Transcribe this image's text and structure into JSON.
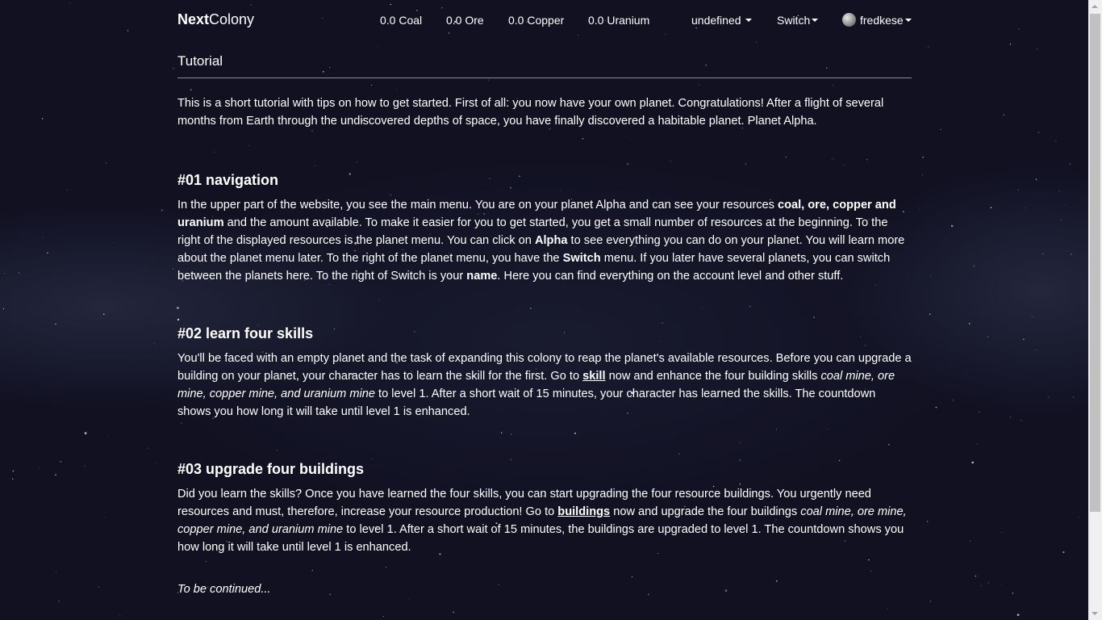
{
  "navbar": {
    "brand_bold": "Next",
    "brand_rest": "Colony",
    "resources": [
      "0.0 Coal",
      "0.0 Ore",
      "0.0 Copper",
      "0.0 Uranium"
    ],
    "planet_menu": "undefined",
    "switch_menu": "Switch",
    "user_menu": "fredkese"
  },
  "page": {
    "title": "Tutorial",
    "intro": "This is a short tutorial with tips on how to get started. First of all: you now have your own planet. Congratulations! After a flight of several months from Earth through the undiscovered depths of space, you have finally discovered a habitable planet. Planet Alpha.",
    "sections": [
      {
        "heading": "#01 navigation",
        "parts": [
          "In the upper part of the website, you see the main menu. You are on your planet Alpha and can see your resources ",
          "coal, ore, copper and uranium",
          " and the amount available. To make it easier for you to get started, you get a small number of resources at the beginning. To the right of the displayed resources is the planet menu. You can click on ",
          "Alpha",
          " to see everything you can do on your planet. You will learn more about the planet menu later. To the right of the planet menu, you have the ",
          "Switch",
          " menu. If you later have several planets, you can switch between the planets here. To the right of Switch is your ",
          "name",
          ". Here you can find everything on the account level and other stuff."
        ]
      },
      {
        "heading": "#02 learn four skills",
        "parts": [
          "You'll be faced with an empty planet and the task of expanding this colony to reap the planet's available resources. Before you can upgrade a building on your planet, your character has to learn the skill for the first. Go to ",
          "skill",
          " now and enhance the four building skills ",
          "coal mine, ore mine, copper mine, and uranium mine",
          " to level 1. After a short wait of 15 minutes, your character has learned the skills. The countdown shows you how long it will take until level 1 is enhanced."
        ]
      },
      {
        "heading": "#03 upgrade four buildings",
        "parts": [
          "Did you learn the skills? Once you have learned the four skills, you can start upgrading the four resource buildings. You urgently need resources and must, therefore, increase your resource production! Go to ",
          "buildings",
          " now and upgrade the four buildings ",
          "coal mine, ore mine, copper mine, and uranium mine",
          " to level 1. After a short wait of 15 minutes, the buildings are upgraded to level 1. The countdown shows you how long it will take until level 1 is enhanced."
        ]
      }
    ],
    "outro": "To be continued..."
  }
}
